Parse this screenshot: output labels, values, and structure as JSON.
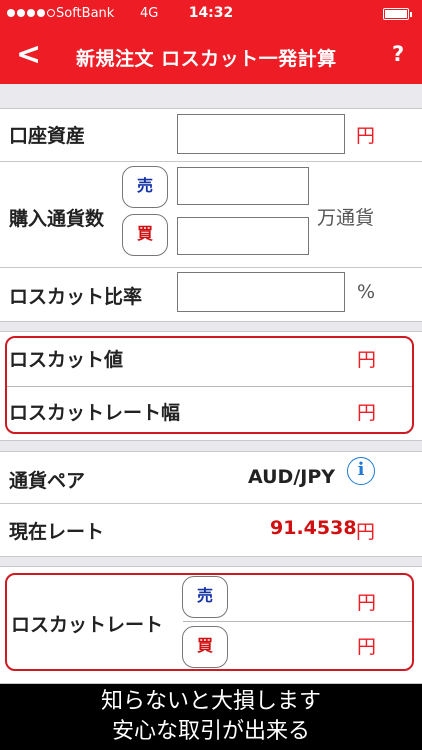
{
  "status_bar": {
    "carrier": "SoftBank",
    "network": "4G",
    "time": "14:32"
  },
  "nav": {
    "back": "<",
    "title": "新規注文 ロスカット一発計算",
    "help": "?"
  },
  "form": {
    "account_assets": {
      "label": "口座資産",
      "unit": "円"
    },
    "purchase_amount": {
      "label": "購入通貨数",
      "sell": "売",
      "buy": "買",
      "unit": "万通貨"
    },
    "losscut_ratio": {
      "label": "ロスカット比率",
      "unit": "%"
    }
  },
  "results": {
    "losscut_value": {
      "label": "ロスカット値",
      "unit": "円"
    },
    "losscut_width": {
      "label": "ロスカットレート幅",
      "unit": "円"
    }
  },
  "currency": {
    "pair_label": "通貨ペア",
    "pair_value": "AUD/JPY",
    "info": "i",
    "rate_label": "現在レート",
    "rate_value": "91.4538",
    "rate_unit": "円"
  },
  "losscut_rate": {
    "label": "ロスカットレート",
    "sell": "売",
    "buy": "買",
    "unit": "円"
  },
  "footer": {
    "line1": "知らないと大損します",
    "line2": "安心な取引が出来る"
  },
  "colors": {
    "accent": "#ee1c24",
    "sell": "#1533a8",
    "buy": "#d01010",
    "info": "#1e7ad6"
  }
}
